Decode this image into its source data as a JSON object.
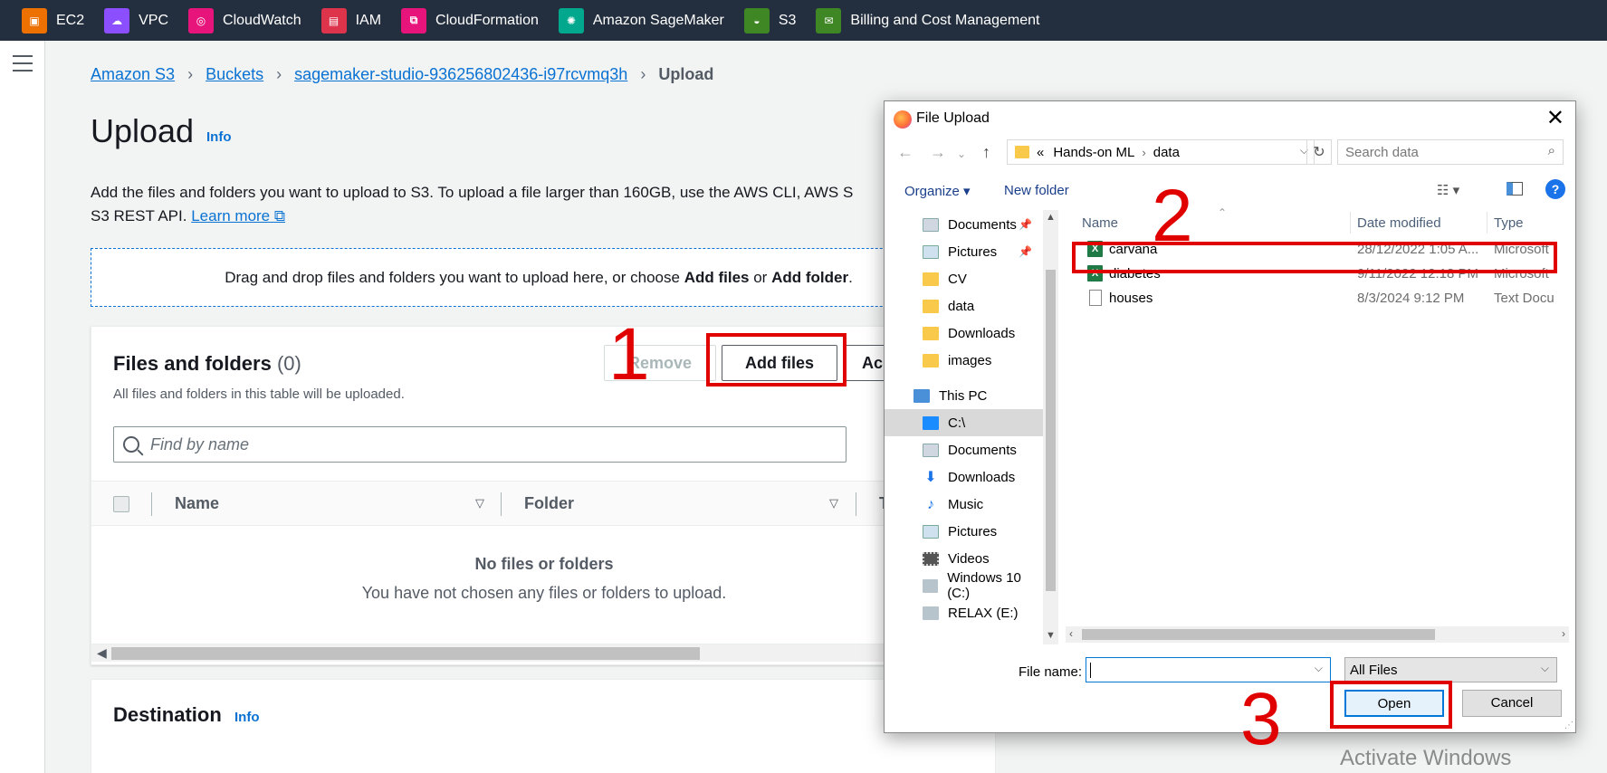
{
  "topbar": {
    "services": [
      {
        "label": "EC2",
        "icon": "ec2-icon",
        "color": "#ed7100"
      },
      {
        "label": "VPC",
        "icon": "vpc-icon",
        "color": "#8c4fff"
      },
      {
        "label": "CloudWatch",
        "icon": "cloudwatch-icon",
        "color": "#e7157b"
      },
      {
        "label": "IAM",
        "icon": "iam-icon",
        "color": "#dd344c"
      },
      {
        "label": "CloudFormation",
        "icon": "cloudformation-icon",
        "color": "#e7157b"
      },
      {
        "label": "Amazon SageMaker",
        "icon": "sagemaker-icon",
        "color": "#01a88d"
      },
      {
        "label": "S3",
        "icon": "s3-icon",
        "color": "#3f8624"
      },
      {
        "label": "Billing and Cost Management",
        "icon": "billing-icon",
        "color": "#3f8624"
      }
    ]
  },
  "breadcrumb": {
    "items": [
      "Amazon S3",
      "Buckets",
      "sagemaker-studio-936256802436-i97rcvmq3h"
    ],
    "current": "Upload"
  },
  "page": {
    "title": "Upload",
    "info": "Info",
    "desc_line1": "Add the files and folders you want to upload to S3. To upload a file larger than 160GB, use the AWS CLI, AWS S",
    "desc_line2": "S3 REST API.",
    "learn_more": "Learn more",
    "drop_pre": "Drag and drop files and folders you want to upload here, or choose",
    "drop_add_files": "Add files",
    "drop_or": "or",
    "drop_add_folder": "Add folder",
    "drop_end": "."
  },
  "files_panel": {
    "title": "Files and folders",
    "count": "(0)",
    "subtitle": "All files and folders in this table will be uploaded.",
    "remove": "Remove",
    "add_files": "Add files",
    "add_folder": "Ac",
    "search_placeholder": "Find by name",
    "col_name": "Name",
    "col_folder": "Folder",
    "col_type": "T",
    "empty_title": "No files or folders",
    "empty_desc": "You have not chosen any files or folders to upload."
  },
  "destination": {
    "title": "Destination",
    "info": "Info"
  },
  "annotations": {
    "n1": "1",
    "n2": "2",
    "n3": "3",
    "color": "#e00000"
  },
  "dialog": {
    "title": "File Upload",
    "path_prefix": "«",
    "path": [
      "Hands-on ML",
      "data"
    ],
    "search_placeholder": "Search data",
    "organize": "Organize ▾",
    "new_folder": "New folder",
    "nav_items": [
      {
        "label": "Documents",
        "icon": "documents-icon",
        "pinned": true
      },
      {
        "label": "Pictures",
        "icon": "pictures-icon",
        "pinned": true
      },
      {
        "label": "CV",
        "icon": "folder-icon"
      },
      {
        "label": "data",
        "icon": "folder-icon"
      },
      {
        "label": "Downloads",
        "icon": "folder-icon"
      },
      {
        "label": "images",
        "icon": "folder-icon"
      },
      {
        "label": "This PC",
        "icon": "this-pc-icon"
      },
      {
        "label": "C:\\",
        "icon": "drive-icon",
        "selected": true
      },
      {
        "label": "Documents",
        "icon": "documents-icon"
      },
      {
        "label": "Downloads",
        "icon": "downloads-icon"
      },
      {
        "label": "Music",
        "icon": "music-icon"
      },
      {
        "label": "Pictures",
        "icon": "pictures-icon"
      },
      {
        "label": "Videos",
        "icon": "videos-icon"
      },
      {
        "label": "Windows 10 (C:)",
        "icon": "windows-drive-icon"
      },
      {
        "label": "RELAX (E:)",
        "icon": "usb-drive-icon"
      }
    ],
    "columns": {
      "name": "Name",
      "date": "Date modified",
      "type": "Type"
    },
    "files": [
      {
        "name": "carvana",
        "date": "28/12/2022 1:05 A...",
        "type": "Microsoft",
        "icon": "excel-icon"
      },
      {
        "name": "diabetes",
        "date": "9/11/2022 12:18 PM",
        "type": "Microsoft",
        "icon": "excel-icon"
      },
      {
        "name": "houses",
        "date": "8/3/2024 9:12 PM",
        "type": "Text Docu",
        "icon": "text-file-icon"
      }
    ],
    "file_name_label": "File name:",
    "file_name_value": "",
    "file_type": "All Files",
    "open": "Open",
    "cancel": "Cancel"
  },
  "watermark": "Activate Windows"
}
